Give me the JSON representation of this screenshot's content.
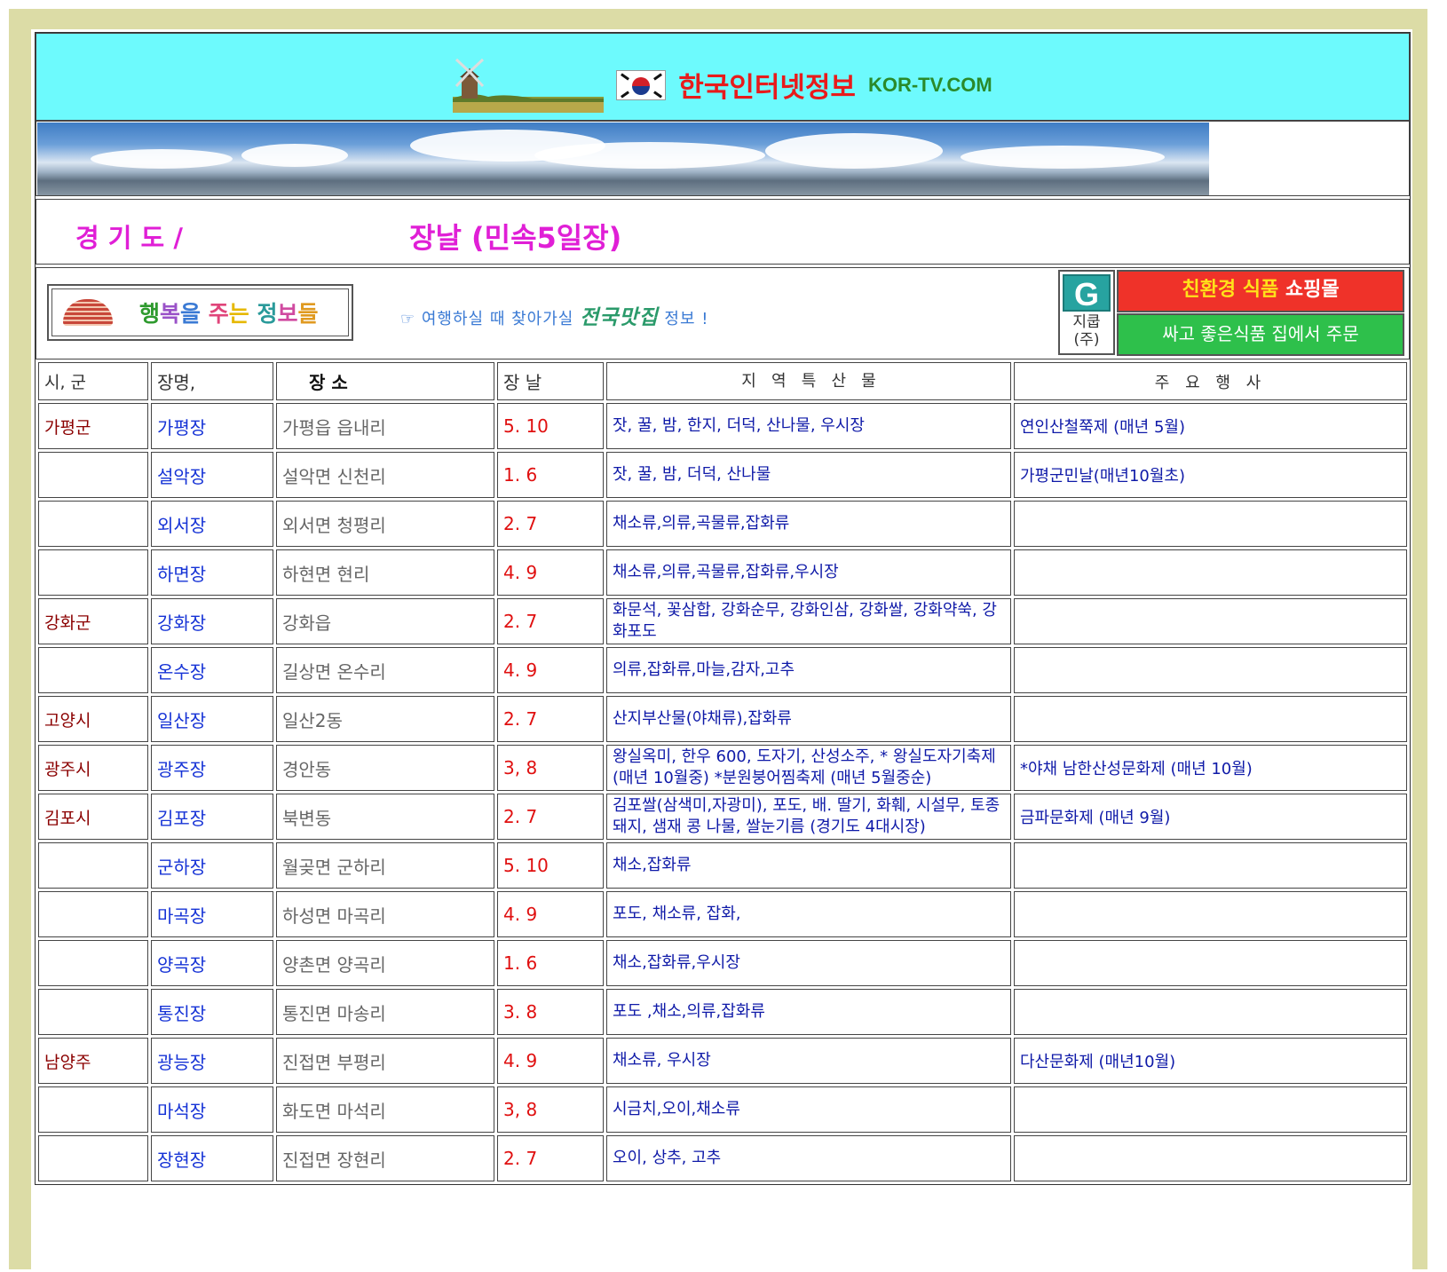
{
  "header": {
    "title": "한국인터넷정보",
    "site": "KOR-TV.COM"
  },
  "region": {
    "province": "경 기 도 /",
    "title": "장날 (민속5일장)"
  },
  "info": {
    "happy_chars": [
      "행",
      "복",
      "을",
      " ",
      "주",
      "는",
      " ",
      "정",
      "보",
      "들"
    ],
    "tour_prefix": "☞   여행하실 때 찾아가실 ",
    "tour_em": "전국맛집",
    "tour_suffix": "  정보 !",
    "company_logo_letter": "G",
    "company_name_1": "지쿱",
    "company_name_2": "(주)",
    "shop1_prefix": "친환경 식품",
    "shop1_suffix": " 쇼핑몰",
    "shop2": "싸고 좋은식품 집에서 주문"
  },
  "colors": {
    "header_bg": "#6dfafd",
    "title_red": "#e81b1b",
    "province_magenta": "#e01fd6",
    "shop_red": "#ef3229",
    "shop_green": "#2ec04b"
  },
  "table": {
    "headers": [
      "시, 군",
      "장명,",
      "장 소",
      "장 날",
      "지   역   특   산   물",
      "주 요 행 사"
    ],
    "rows": [
      {
        "city": "가평군",
        "name": "가평장",
        "place": "가평읍 읍내리",
        "day": "5. 10",
        "products": "잣, 꿀, 밤, 한지, 더덕, 산나물, 우시장",
        "event": "연인산철쭉제 (매년 5월)"
      },
      {
        "city": "",
        "name": "설악장",
        "place": "설악면 신천리",
        "day": "1.  6",
        "products": "잣, 꿀, 밤, 더덕, 산나물",
        "event": "가평군민날(매년10월초)"
      },
      {
        "city": "",
        "name": "외서장",
        "place": "외서면 청평리",
        "day": "2.  7",
        "products": "채소류,의류,곡물류,잡화류",
        "event": ""
      },
      {
        "city": "",
        "name": "하면장",
        "place": "하현면 현리",
        "day": "4.  9",
        "products": "채소류,의류,곡물류,잡화류,우시장",
        "event": ""
      },
      {
        "city": "강화군",
        "name": "강화장",
        "place": "강화읍",
        "day": "2.  7",
        "products": "화문석, 꽃삼합, 강화순무, 강화인삼, 강화쌀, 강화약쑥, 강화포도",
        "event": ""
      },
      {
        "city": "",
        "name": "온수장",
        "place": "길상면 온수리",
        "day": "4.  9",
        "products": "의류,잡화류,마늘,감자,고추",
        "event": ""
      },
      {
        "city": "고양시",
        "name": "일산장",
        "place": "일산2동",
        "day": "2.  7",
        "products": "산지부산물(야채류),잡화류",
        "event": ""
      },
      {
        "city": "광주시",
        "name": "광주장",
        "place": "경안동",
        "day": "3,  8",
        "products": "왕실옥미, 한우 600, 도자기, 산성소주, * 왕실도자기축제 (매년 10월중) *분원붕어찜축제 (매년 5월중순)",
        "event": "*야채 남한산성문화제  (매년 10월)"
      },
      {
        "city": "김포시",
        "name": "김포장",
        "place": "북변동",
        "day": "2.  7",
        "products": "김포쌀(삼색미,자광미), 포도, 배. 딸기, 화훼, 시설무, 토종돼지, 샘재  콩  나물, 쌀눈기름 (경기도 4대시장)",
        "event": "금파문화제 (매년 9월)"
      },
      {
        "city": "",
        "name": "군하장",
        "place": "월곶면 군하리",
        "day": "5. 10",
        "products": "채소,잡화류",
        "event": ""
      },
      {
        "city": "",
        "name": "마곡장",
        "place": "하성면 마곡리",
        "day": "4.  9",
        "products": "포도, 채소류, 잡화,",
        "event": ""
      },
      {
        "city": "",
        "name": "양곡장",
        "place": "양촌면 양곡리",
        "day": "1.  6",
        "products": "채소,잡화류,우시장",
        "event": ""
      },
      {
        "city": "",
        "name": "통진장",
        "place": "통진면 마송리",
        "day": "3.  8",
        "products": "포도 ,채소,의류,잡화류",
        "event": ""
      },
      {
        "city": "남양주",
        "name": "광능장",
        "place": "진접면 부평리",
        "day": "4.  9",
        "products": "채소류, 우시장",
        "event": "다산문화제 (매년10월)"
      },
      {
        "city": "",
        "name": "마석장",
        "place": "화도면 마석리",
        "day": "3,  8",
        "products": "시금치,오이,채소류",
        "event": ""
      },
      {
        "city": "",
        "name": "장현장",
        "place": "진접면 장현리",
        "day": "2.  7",
        "products": "오이, 상추, 고추",
        "event": ""
      }
    ]
  }
}
